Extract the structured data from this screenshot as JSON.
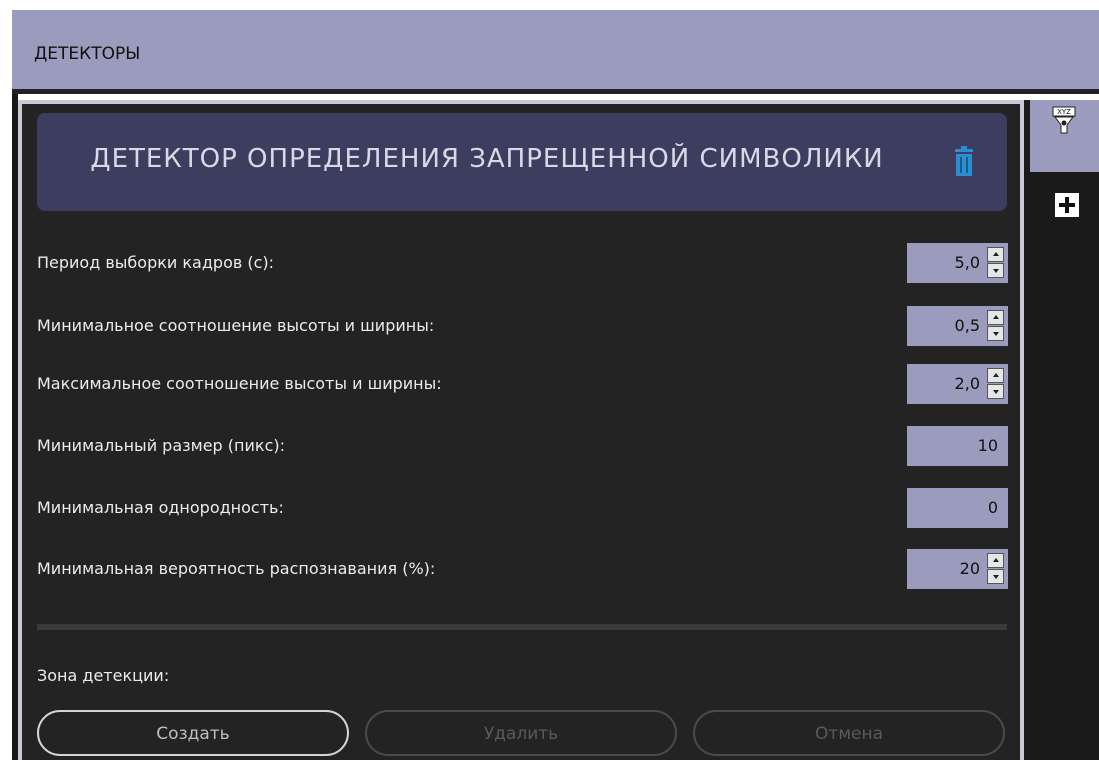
{
  "window": {
    "title": "ДЕТЕКТОРЫ"
  },
  "detector": {
    "title": "ДЕТЕКТОР ОПРЕДЕЛЕНИЯ ЗАПРЕЩЕННОЙ СИМВОЛИКИ",
    "delete_icon": "trash-icon"
  },
  "params": [
    {
      "label": "Период выборки кадров (с):",
      "value": "5,0",
      "has_arrows": true
    },
    {
      "label": "Минимальное соотношение высоты и ширины:",
      "value": "0,5",
      "has_arrows": true
    },
    {
      "label": "Максимальное соотношение высоты и ширины:",
      "value": "2,0",
      "has_arrows": true
    },
    {
      "label": "Минимальный размер (пикс):",
      "value": "10",
      "has_arrows": false
    },
    {
      "label": "Минимальная однородность:",
      "value": "0",
      "has_arrows": false
    },
    {
      "label": "Минимальная вероятность распознавания (%):",
      "value": "20",
      "has_arrows": true
    }
  ],
  "zone": {
    "label": "Зона детекции:",
    "create_label": "Создать",
    "delete_label": "Удалить",
    "cancel_label": "Отмена"
  },
  "sidebar": {
    "tab_icon": "xyz-sensor-icon",
    "add_icon": "plus-icon"
  },
  "colors": {
    "accent": "#9b9bbd",
    "header_bg": "#3d3e5f",
    "panel_bg": "#232323",
    "trash": "#2a8fd0"
  }
}
